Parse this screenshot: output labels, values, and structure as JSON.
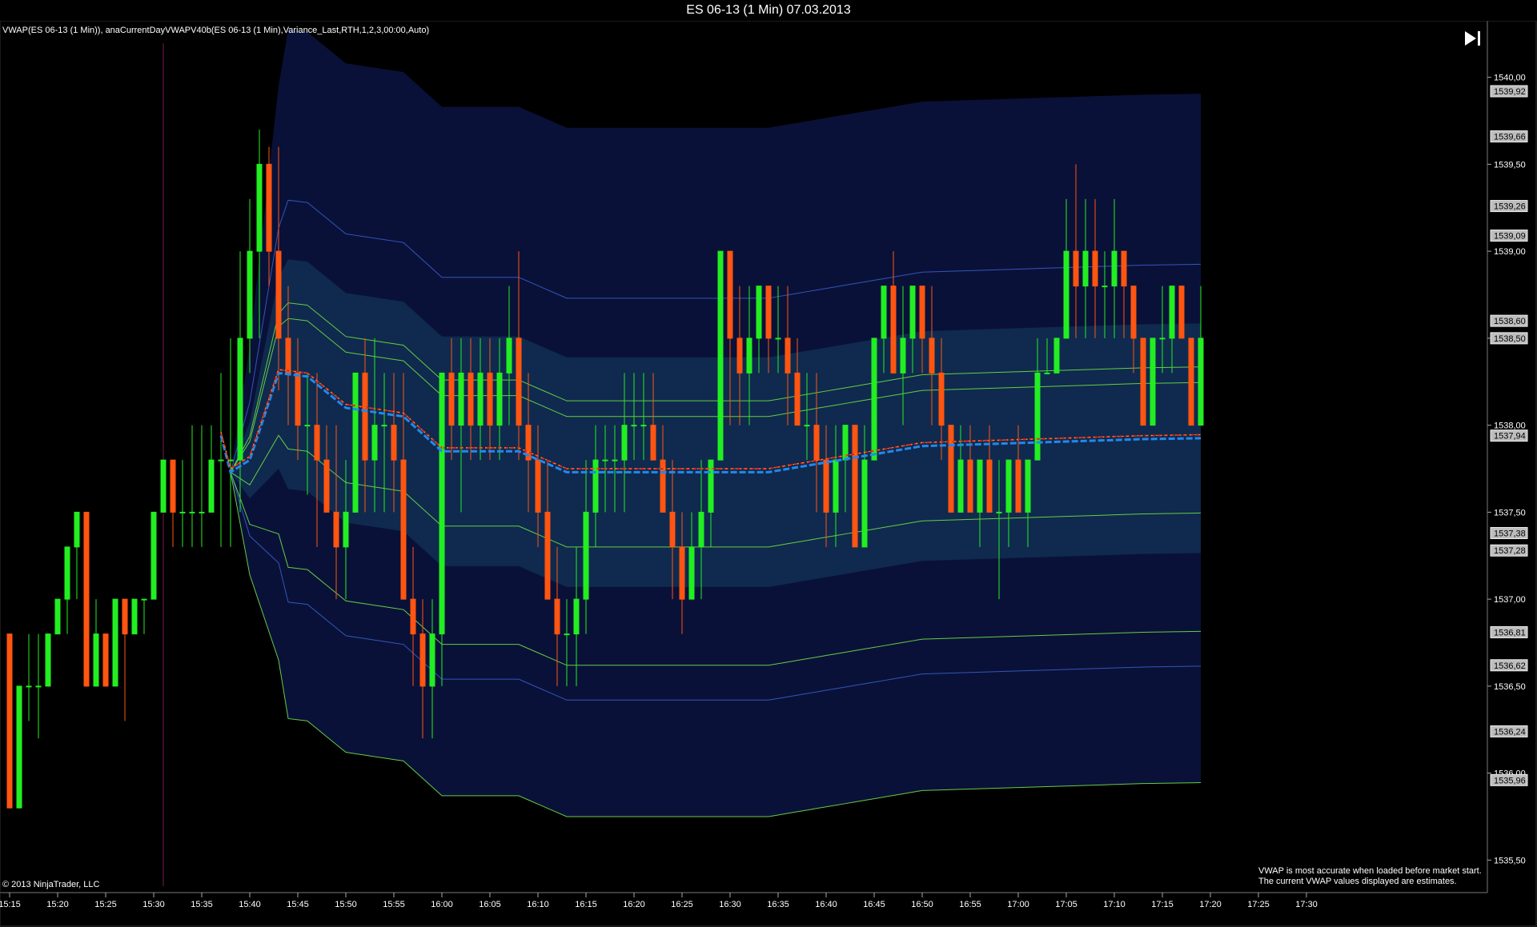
{
  "window": {
    "title": "ES 06-13 (1 Min)  07.03.2013"
  },
  "indicator_label": "VWAP(ES 06-13 (1 Min)), anaCurrentDayVWAPV40b(ES 06-13 (1 Min),Variance_Last,RTH,1,2,3,00:00,Auto)",
  "copyright": "© 2013 NinjaTrader, LLC",
  "note_line1": "VWAP is most accurate when loaded before market start.",
  "note_line2": "The current VWAP values displayed are estimates.",
  "go_to_end_icon": "skip-to-end-icon",
  "colors": {
    "background": "#000000",
    "outer_band": "#0a1138",
    "inner_band": "#0f2a4e",
    "up_candle": "#22ee22",
    "down_candle": "#ff5511",
    "vwap": "#2288ee",
    "current_vwap": "#dd2222",
    "band_line_green": "#66cc44",
    "band_line_blue": "#3355bb"
  },
  "chart_data": {
    "type": "candlestick",
    "title": "ES 06-13 (1 Min)  07.03.2013",
    "session_start": "15:30",
    "x_ticks": [
      "15:15",
      "15:20",
      "15:25",
      "15:30",
      "15:35",
      "15:40",
      "15:45",
      "15:50",
      "15:55",
      "16:00",
      "16:05",
      "16:10",
      "16:15",
      "16:20",
      "16:25",
      "16:30",
      "16:35",
      "16:40",
      "16:45",
      "16:50",
      "16:55",
      "17:00",
      "17:05",
      "17:10",
      "17:15",
      "17:20",
      "17:25",
      "17:30"
    ],
    "y_ticks": [
      "1540,00",
      "1539,50",
      "1539,00",
      "1538,50",
      "1538,00",
      "1537,50",
      "1537,00",
      "1536,50",
      "1536,00",
      "1535,50"
    ],
    "ylim": [
      1535.35,
      1540.15
    ],
    "price_tags": [
      {
        "label": "1539,92",
        "value": 1539.92
      },
      {
        "label": "1539,66",
        "value": 1539.66
      },
      {
        "label": "1539,26",
        "value": 1539.26
      },
      {
        "label": "1539,09",
        "value": 1539.09
      },
      {
        "label": "1538,60",
        "value": 1538.6
      },
      {
        "label": "1538,50",
        "value": 1538.5
      },
      {
        "label": "1537,94",
        "value": 1537.94
      },
      {
        "label": "1537,38",
        "value": 1537.38
      },
      {
        "label": "1537,28",
        "value": 1537.28
      },
      {
        "label": "1536,81",
        "value": 1536.81
      },
      {
        "label": "1536,62",
        "value": 1536.62
      },
      {
        "label": "1536,24",
        "value": 1536.24
      },
      {
        "label": "1535,96",
        "value": 1535.96
      }
    ],
    "vwap_keyframes": [
      [
        0,
        1537.73
      ],
      [
        2,
        1537.8
      ],
      [
        5,
        1538.3
      ],
      [
        8,
        1538.28
      ],
      [
        12,
        1538.1
      ],
      [
        18,
        1538.05
      ],
      [
        22,
        1537.85
      ],
      [
        30,
        1537.85
      ],
      [
        35,
        1537.73
      ],
      [
        56,
        1537.73
      ],
      [
        72,
        1537.88
      ],
      [
        95,
        1537.92
      ],
      [
        118,
        1537.94
      ]
    ],
    "band_offsets": [
      1.0,
      0.41,
      0.32,
      -0.43,
      -1.11,
      -1.31,
      -1.98
    ],
    "band_edges_upper": 1.98,
    "band_edges_inner": 0.66,
    "candles": [
      {
        "o": 1536.8,
        "h": 1536.8,
        "l": 1535.8,
        "c": 1535.8
      },
      {
        "o": 1535.8,
        "h": 1536.5,
        "l": 1535.8,
        "c": 1536.5
      },
      {
        "o": 1536.5,
        "h": 1536.8,
        "l": 1536.3,
        "c": 1536.5
      },
      {
        "o": 1536.5,
        "h": 1536.8,
        "l": 1536.2,
        "c": 1536.5
      },
      {
        "o": 1536.5,
        "h": 1536.8,
        "l": 1536.5,
        "c": 1536.8
      },
      {
        "o": 1536.8,
        "h": 1537.0,
        "l": 1536.8,
        "c": 1537.0
      },
      {
        "o": 1537.0,
        "h": 1537.3,
        "l": 1536.8,
        "c": 1537.3
      },
      {
        "o": 1537.3,
        "h": 1537.5,
        "l": 1537.0,
        "c": 1537.5
      },
      {
        "o": 1537.5,
        "h": 1537.5,
        "l": 1536.8,
        "c": 1536.5
      },
      {
        "o": 1536.5,
        "h": 1537.0,
        "l": 1536.5,
        "c": 1536.8
      },
      {
        "o": 1536.8,
        "h": 1536.8,
        "l": 1536.5,
        "c": 1536.5
      },
      {
        "o": 1536.5,
        "h": 1537.0,
        "l": 1536.5,
        "c": 1537.0
      },
      {
        "o": 1537.0,
        "h": 1537.0,
        "l": 1536.3,
        "c": 1536.8
      },
      {
        "o": 1536.8,
        "h": 1537.0,
        "l": 1536.8,
        "c": 1537.0
      },
      {
        "o": 1537.0,
        "h": 1537.0,
        "l": 1536.8,
        "c": 1537.0
      },
      {
        "o": 1537.0,
        "h": 1537.5,
        "l": 1537.0,
        "c": 1537.5
      },
      {
        "o": 1537.5,
        "h": 1537.8,
        "l": 1537.5,
        "c": 1537.8
      },
      {
        "o": 1537.8,
        "h": 1537.8,
        "l": 1537.3,
        "c": 1537.5
      },
      {
        "o": 1537.5,
        "h": 1537.8,
        "l": 1537.3,
        "c": 1537.5
      },
      {
        "o": 1537.5,
        "h": 1538.0,
        "l": 1537.3,
        "c": 1537.5
      },
      {
        "o": 1537.5,
        "h": 1538.0,
        "l": 1537.3,
        "c": 1537.5
      },
      {
        "o": 1537.5,
        "h": 1538.0,
        "l": 1537.5,
        "c": 1537.8
      },
      {
        "o": 1537.8,
        "h": 1538.3,
        "l": 1537.3,
        "c": 1537.8
      },
      {
        "o": 1537.8,
        "h": 1538.5,
        "l": 1537.3,
        "c": 1537.8
      },
      {
        "o": 1537.8,
        "h": 1539.0,
        "l": 1537.5,
        "c": 1538.5
      },
      {
        "o": 1538.5,
        "h": 1539.3,
        "l": 1538.3,
        "c": 1539.0
      },
      {
        "o": 1539.0,
        "h": 1539.7,
        "l": 1538.5,
        "c": 1539.5
      },
      {
        "o": 1539.5,
        "h": 1539.6,
        "l": 1538.8,
        "c": 1539.0
      },
      {
        "o": 1539.0,
        "h": 1539.6,
        "l": 1538.2,
        "c": 1538.5
      },
      {
        "o": 1538.5,
        "h": 1538.8,
        "l": 1538.0,
        "c": 1538.3
      },
      {
        "o": 1538.3,
        "h": 1538.5,
        "l": 1537.8,
        "c": 1538.0
      },
      {
        "o": 1538.0,
        "h": 1538.3,
        "l": 1537.6,
        "c": 1538.0
      },
      {
        "o": 1538.0,
        "h": 1538.3,
        "l": 1537.3,
        "c": 1537.8
      },
      {
        "o": 1537.8,
        "h": 1538.0,
        "l": 1537.5,
        "c": 1537.5
      },
      {
        "o": 1537.5,
        "h": 1538.0,
        "l": 1537.0,
        "c": 1537.3
      },
      {
        "o": 1537.3,
        "h": 1537.8,
        "l": 1537.0,
        "c": 1537.5
      },
      {
        "o": 1537.5,
        "h": 1538.3,
        "l": 1537.5,
        "c": 1538.3
      },
      {
        "o": 1538.3,
        "h": 1538.5,
        "l": 1537.5,
        "c": 1537.8
      },
      {
        "o": 1537.8,
        "h": 1538.5,
        "l": 1537.5,
        "c": 1538.0
      },
      {
        "o": 1538.0,
        "h": 1538.3,
        "l": 1537.5,
        "c": 1538.0
      },
      {
        "o": 1538.0,
        "h": 1538.3,
        "l": 1537.5,
        "c": 1537.8
      },
      {
        "o": 1537.8,
        "h": 1538.3,
        "l": 1537.0,
        "c": 1537.0
      },
      {
        "o": 1537.0,
        "h": 1537.3,
        "l": 1536.5,
        "c": 1536.8
      },
      {
        "o": 1536.8,
        "h": 1537.0,
        "l": 1536.2,
        "c": 1536.5
      },
      {
        "o": 1536.5,
        "h": 1537.0,
        "l": 1536.2,
        "c": 1536.8
      },
      {
        "o": 1536.8,
        "h": 1538.3,
        "l": 1536.5,
        "c": 1538.3
      },
      {
        "o": 1538.3,
        "h": 1538.5,
        "l": 1537.8,
        "c": 1538.0
      },
      {
        "o": 1538.0,
        "h": 1538.5,
        "l": 1537.5,
        "c": 1538.3
      },
      {
        "o": 1538.3,
        "h": 1538.5,
        "l": 1537.8,
        "c": 1538.0
      },
      {
        "o": 1538.0,
        "h": 1538.5,
        "l": 1537.8,
        "c": 1538.3
      },
      {
        "o": 1538.3,
        "h": 1538.5,
        "l": 1537.8,
        "c": 1538.0
      },
      {
        "o": 1538.0,
        "h": 1538.5,
        "l": 1537.8,
        "c": 1538.3
      },
      {
        "o": 1538.3,
        "h": 1538.8,
        "l": 1538.0,
        "c": 1538.5
      },
      {
        "o": 1538.5,
        "h": 1539.0,
        "l": 1537.8,
        "c": 1538.0
      },
      {
        "o": 1538.0,
        "h": 1538.3,
        "l": 1537.5,
        "c": 1537.8
      },
      {
        "o": 1537.8,
        "h": 1538.0,
        "l": 1537.3,
        "c": 1537.5
      },
      {
        "o": 1537.5,
        "h": 1537.8,
        "l": 1537.0,
        "c": 1537.0
      },
      {
        "o": 1537.0,
        "h": 1537.3,
        "l": 1536.5,
        "c": 1536.8
      },
      {
        "o": 1536.8,
        "h": 1537.0,
        "l": 1536.5,
        "c": 1536.8
      },
      {
        "o": 1536.8,
        "h": 1537.3,
        "l": 1536.5,
        "c": 1537.0
      },
      {
        "o": 1537.0,
        "h": 1537.8,
        "l": 1536.8,
        "c": 1537.5
      },
      {
        "o": 1537.5,
        "h": 1538.0,
        "l": 1537.3,
        "c": 1537.8
      },
      {
        "o": 1537.8,
        "h": 1538.0,
        "l": 1537.5,
        "c": 1537.8
      },
      {
        "o": 1537.8,
        "h": 1538.0,
        "l": 1537.5,
        "c": 1537.8
      },
      {
        "o": 1537.8,
        "h": 1538.3,
        "l": 1537.5,
        "c": 1538.0
      },
      {
        "o": 1538.0,
        "h": 1538.3,
        "l": 1537.8,
        "c": 1538.0
      },
      {
        "o": 1538.0,
        "h": 1538.3,
        "l": 1537.8,
        "c": 1538.0
      },
      {
        "o": 1538.0,
        "h": 1538.3,
        "l": 1537.8,
        "c": 1537.8
      },
      {
        "o": 1537.8,
        "h": 1538.0,
        "l": 1537.5,
        "c": 1537.5
      },
      {
        "o": 1537.5,
        "h": 1537.8,
        "l": 1537.0,
        "c": 1537.3
      },
      {
        "o": 1537.3,
        "h": 1537.5,
        "l": 1536.8,
        "c": 1537.0
      },
      {
        "o": 1537.0,
        "h": 1537.5,
        "l": 1537.0,
        "c": 1537.3
      },
      {
        "o": 1537.3,
        "h": 1537.8,
        "l": 1537.0,
        "c": 1537.5
      },
      {
        "o": 1537.5,
        "h": 1537.8,
        "l": 1537.3,
        "c": 1537.8
      },
      {
        "o": 1537.8,
        "h": 1539.0,
        "l": 1537.8,
        "c": 1539.0
      },
      {
        "o": 1539.0,
        "h": 1539.0,
        "l": 1538.0,
        "c": 1538.5
      },
      {
        "o": 1538.5,
        "h": 1538.8,
        "l": 1538.0,
        "c": 1538.3
      },
      {
        "o": 1538.3,
        "h": 1538.8,
        "l": 1538.0,
        "c": 1538.5
      },
      {
        "o": 1538.5,
        "h": 1538.8,
        "l": 1538.3,
        "c": 1538.8
      },
      {
        "o": 1538.8,
        "h": 1538.8,
        "l": 1538.3,
        "c": 1538.5
      },
      {
        "o": 1538.5,
        "h": 1538.8,
        "l": 1538.3,
        "c": 1538.5
      },
      {
        "o": 1538.5,
        "h": 1538.8,
        "l": 1538.0,
        "c": 1538.3
      },
      {
        "o": 1538.3,
        "h": 1538.5,
        "l": 1538.0,
        "c": 1538.0
      },
      {
        "o": 1538.0,
        "h": 1538.3,
        "l": 1537.8,
        "c": 1538.0
      },
      {
        "o": 1538.0,
        "h": 1538.3,
        "l": 1537.5,
        "c": 1537.8
      },
      {
        "o": 1537.8,
        "h": 1538.0,
        "l": 1537.3,
        "c": 1537.5
      },
      {
        "o": 1537.5,
        "h": 1538.0,
        "l": 1537.3,
        "c": 1537.8
      },
      {
        "o": 1537.8,
        "h": 1538.0,
        "l": 1537.5,
        "c": 1538.0
      },
      {
        "o": 1538.0,
        "h": 1538.0,
        "l": 1537.3,
        "c": 1537.3
      },
      {
        "o": 1537.3,
        "h": 1538.0,
        "l": 1537.3,
        "c": 1537.8
      },
      {
        "o": 1537.8,
        "h": 1538.5,
        "l": 1537.8,
        "c": 1538.5
      },
      {
        "o": 1538.5,
        "h": 1538.8,
        "l": 1538.3,
        "c": 1538.8
      },
      {
        "o": 1538.8,
        "h": 1539.0,
        "l": 1538.3,
        "c": 1538.3
      },
      {
        "o": 1538.3,
        "h": 1538.8,
        "l": 1538.0,
        "c": 1538.5
      },
      {
        "o": 1538.5,
        "h": 1538.8,
        "l": 1538.3,
        "c": 1538.8
      },
      {
        "o": 1538.8,
        "h": 1538.8,
        "l": 1538.3,
        "c": 1538.5
      },
      {
        "o": 1538.5,
        "h": 1538.8,
        "l": 1538.0,
        "c": 1538.3
      },
      {
        "o": 1538.3,
        "h": 1538.5,
        "l": 1537.8,
        "c": 1538.0
      },
      {
        "o": 1538.0,
        "h": 1538.0,
        "l": 1537.5,
        "c": 1537.5
      },
      {
        "o": 1537.5,
        "h": 1538.0,
        "l": 1537.5,
        "c": 1537.8
      },
      {
        "o": 1537.8,
        "h": 1538.0,
        "l": 1537.5,
        "c": 1537.5
      },
      {
        "o": 1537.5,
        "h": 1537.8,
        "l": 1537.3,
        "c": 1537.8
      },
      {
        "o": 1537.8,
        "h": 1538.0,
        "l": 1537.5,
        "c": 1537.5
      },
      {
        "o": 1537.5,
        "h": 1537.8,
        "l": 1537.0,
        "c": 1537.5
      },
      {
        "o": 1537.5,
        "h": 1537.8,
        "l": 1537.3,
        "c": 1537.8
      },
      {
        "o": 1537.8,
        "h": 1538.0,
        "l": 1537.5,
        "c": 1537.5
      },
      {
        "o": 1537.5,
        "h": 1537.8,
        "l": 1537.3,
        "c": 1537.8
      },
      {
        "o": 1537.8,
        "h": 1538.5,
        "l": 1537.8,
        "c": 1538.3
      },
      {
        "o": 1538.3,
        "h": 1538.5,
        "l": 1538.3,
        "c": 1538.3
      },
      {
        "o": 1538.3,
        "h": 1538.5,
        "l": 1538.3,
        "c": 1538.5
      },
      {
        "o": 1538.5,
        "h": 1539.3,
        "l": 1538.5,
        "c": 1539.0
      },
      {
        "o": 1539.0,
        "h": 1539.5,
        "l": 1538.5,
        "c": 1538.8
      },
      {
        "o": 1538.8,
        "h": 1539.3,
        "l": 1538.5,
        "c": 1539.0
      },
      {
        "o": 1539.0,
        "h": 1539.3,
        "l": 1538.5,
        "c": 1538.8
      },
      {
        "o": 1538.8,
        "h": 1539.0,
        "l": 1538.5,
        "c": 1538.8
      },
      {
        "o": 1538.8,
        "h": 1539.3,
        "l": 1538.5,
        "c": 1539.0
      },
      {
        "o": 1539.0,
        "h": 1539.0,
        "l": 1538.5,
        "c": 1538.8
      },
      {
        "o": 1538.8,
        "h": 1538.8,
        "l": 1538.3,
        "c": 1538.5
      },
      {
        "o": 1538.5,
        "h": 1538.5,
        "l": 1538.0,
        "c": 1538.0
      },
      {
        "o": 1538.0,
        "h": 1538.5,
        "l": 1538.0,
        "c": 1538.5
      },
      {
        "o": 1538.5,
        "h": 1538.8,
        "l": 1538.3,
        "c": 1538.5
      },
      {
        "o": 1538.5,
        "h": 1538.8,
        "l": 1538.3,
        "c": 1538.8
      },
      {
        "o": 1538.8,
        "h": 1538.8,
        "l": 1538.5,
        "c": 1538.5
      },
      {
        "o": 1538.5,
        "h": 1538.5,
        "l": 1538.0,
        "c": 1538.0
      },
      {
        "o": 1538.0,
        "h": 1538.8,
        "l": 1538.0,
        "c": 1538.5
      }
    ]
  }
}
